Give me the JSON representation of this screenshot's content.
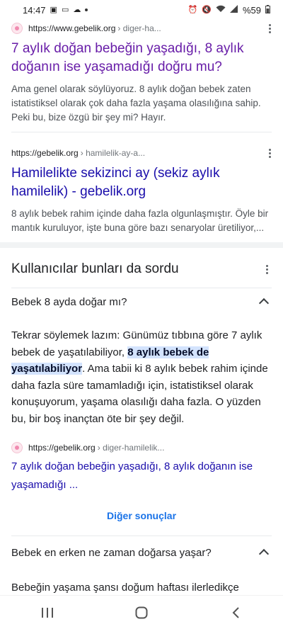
{
  "status_bar": {
    "time": "14:47",
    "battery": "%59"
  },
  "results": [
    {
      "url_main": "https://www.gebelik.org",
      "url_path": "› diger-ha...",
      "title": "7 aylık doğan bebeğin yaşadığı, 8 aylık doğanın ise yaşamadığı doğru mu?",
      "snippet": "Ama genel olarak söylüyoruz. 8 aylık doğan bebek zaten istatistiksel olarak çok daha fazla yaşama olasılığına sahip. Peki bu, bize özgü bir şey mi? Hayır."
    },
    {
      "url_main": "https://gebelik.org",
      "url_path": "› hamilelik-ay-a...",
      "title": "Hamilelikte sekizinci ay (sekiz aylık hamilelik) - gebelik.org",
      "snippet": "8 aylık bebek rahim içinde daha fazla olgunlaşmıştır. Öyle bir mantık kuruluyor, işte buna göre bazı senaryolar üretiliyor,..."
    }
  ],
  "paa": {
    "heading": "Kullanıcılar bunları da sordu",
    "questions": [
      {
        "question": "Bebek 8 ayda doğar mı?",
        "answer_before": "Tekrar söylemek lazım: Günümüz tıbbına göre 7 aylık bebek de yaşatılabiliyor, ",
        "answer_highlight": "8 aylık bebek de yaşatılabiliyor",
        "answer_after": ". Ama tabii ki 8 aylık bebek rahim içinde daha fazla süre tamamladığı için, istatistiksel olarak konuşuyorum, yaşama olasılığı daha fazla. O yüzden bu, bir boş inançtan öte bir şey değil.",
        "source_main": "https://gebelik.org",
        "source_path": "› diger-hamilelik...",
        "link_title": "7 aylık doğan bebeğin yaşadığı, 8 aylık doğanın ise yaşamadığı ..."
      },
      {
        "question": "Bebek en erken ne zaman doğarsa yaşar?",
        "answer_start": "Bebeğin yaşama şansı doğum haftası ilerledikçe"
      }
    ],
    "more_results": "Diğer sonuçlar"
  }
}
